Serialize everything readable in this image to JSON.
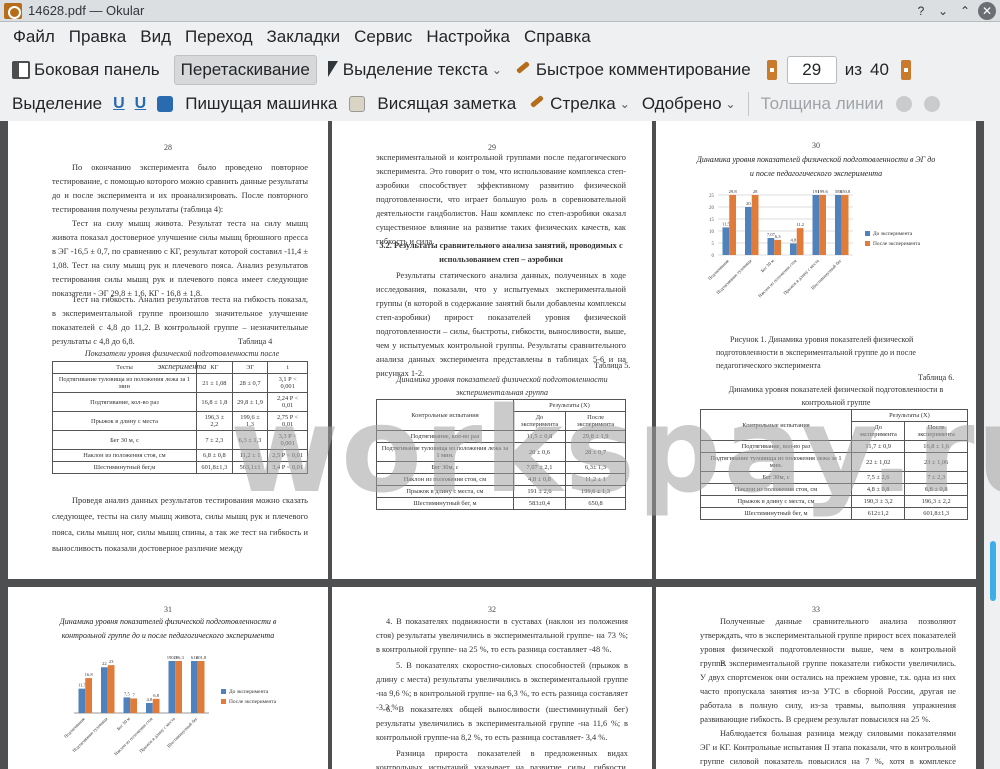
{
  "window": {
    "title": "14628.pdf — Okular"
  },
  "menu": [
    "Файл",
    "Правка",
    "Вид",
    "Переход",
    "Закладки",
    "Сервис",
    "Настройка",
    "Справка"
  ],
  "toolbar1": {
    "sidebar": "Боковая панель",
    "drag": "Перетаскивание",
    "text_select": "Выделение текста",
    "quick_comment": "Быстрое комментирование",
    "current_page": "29",
    "of_label": "из",
    "total_pages": "40"
  },
  "toolbar2": {
    "highlight": "Выделение",
    "typewriter": "Пишущая машинка",
    "sticky_note": "Висящая заметка",
    "arrow": "Стрелка",
    "approved": "Одобрено",
    "line_width": "Толщина линии"
  },
  "watermark": "workspay.ru",
  "pages": {
    "p28": {
      "num": "28",
      "paras": [
        "По окончанию эксперимента было проведено повторное тестирование, с помощью которого можно сравнить данные результаты до и после эксперимента и их проанализировать. После повторного тестирования получены результаты (таблица 4):",
        "Тест на силу мышц живота. Результат теста на силу мышц живота показал достоверное улучшение силы мышц брюшного пресса в ЭГ -16,5 ± 0,7, по сравнению с КГ, результат которой составил -11,4 ± 1,08.",
        "Тест на силу мышц рук и плечевого пояса. Анализ результатов тестирования силы мышц рук и плечевого пояса имеет следующие показатели - ЭГ 29,8 ± 1,6, КГ - 16,8 ± 1,8.",
        "Тест на гибкость. Анализ результатов теста на гибкость показал, в экспериментальной группе произошло значительное улучшение показателей с 4,8 до 11,2. В контрольной группе – незначительные результаты с 4,8 до 6,8."
      ],
      "table_label": "Таблица 4",
      "table_title": "Показатели уровня физической подготовленности после эксперимента",
      "table_head": [
        "Тесты",
        "КГ",
        "ЭГ",
        "t"
      ],
      "table_rows": [
        [
          "Подтягивание туловища из положения лежа за 1 мин",
          "21 ± 1,08",
          "28 ± 0,7",
          "3,1 P < 0,001"
        ],
        [
          "Подтягивание, кол-во раз",
          "16,8 ± 1,8",
          "29,8 ± 1,9",
          "2,24 P < 0,01"
        ],
        [
          "Прыжок в длину с места",
          "196,3 ± 2,2",
          "199,6 ± 1,3",
          "2,75 P < 0,01"
        ],
        [
          "Бег 30 м, с",
          "7 ± 2,3",
          "6,3 ± 1,3",
          "3,3 P < 0,001"
        ],
        [
          "Наклон из положения стоя, см",
          "6,8 ± 0,8",
          "11,2 ± 1",
          "2,5 P < 0,01"
        ],
        [
          "Шестиминутный бег,м",
          "601,8±1,3",
          "563,1±1",
          "3,4 P < 0,01"
        ]
      ],
      "after": "Проведя анализ данных результатов тестирования можно сказать следующее, тесты на силу мышц живота, силы мышц рук и плечевого пояса, силы мышц ног, силы мышц спины, а так же тест на гибкость и выносливость показали достоверное различие между"
    },
    "p29": {
      "num": "29",
      "para1": "экспериментальной и контрольной группами после педагогического эксперимента. Это говорит о том, что использование комплекса степ-аэробики способствует эффективному развитию физической подготовленности, что играет большую роль в соревновательной деятельности гандболистов. Наш комплекс по степ-аэробики оказал существенное влияние на развитие таких физических качеств, как гибкость и сила.",
      "heading": "3.2. Результаты сравнительного анализа занятий, проводимых с использованием степ – аэробики",
      "para2": "Результаты статического анализа данных, полученных в ходе исследования, показали, что у испытуемых экспериментальной группы (в которой в содержание занятий были добавлены комплексы степ-аэробики) прирост показателей уровня физической подготовленности – силы, быстроты, гибкости, выносливости, выше, чем у испытуемых контрольной группы. Результаты сравнительного анализа данных эксперимента представлены в таблицах 5-6 и на рисунках 1-2.",
      "table_label": "Таблица 5.",
      "table_title": "Динамика уровня показателей физической подготовленности экспериментальная группа",
      "head_test": "Контрольные испытания",
      "head_results": "Результаты (X)",
      "head_before": "До эксперимента",
      "head_after": "После эксперимента",
      "rows": [
        [
          "Подтягивание, кол-во раз",
          "11,5 ± 0,8",
          "29,8 ± 1,9"
        ],
        [
          "Подтягивание туловища из положения лежа за 1 мин.",
          "20 ± 0,6",
          "28 ± 0,7"
        ],
        [
          "Бег 30м, с",
          "7,07 ± 2,1",
          "6,3± 1,3"
        ],
        [
          "Наклон из положения стоя, см",
          "4,8 ± 0,8",
          "11,2 ± 1"
        ],
        [
          "Прыжок в длину с места, см",
          "191 ± 2,6",
          "199,6 ± 1,3"
        ],
        [
          "Шестиминутный бег, м",
          "583±0,4",
          "650,8"
        ]
      ]
    },
    "p30": {
      "num": "30",
      "chart_title": "Динамика уровня показателей физической подготовленности в ЭГ до и после педагогического эксперимента",
      "caption": "Рисунок 1. Динамика уровня показателей физической подготовленности в экспериментальной группе до и после педагогического эксперимента",
      "table_label": "Таблица 6.",
      "table_title": "Динамика уровня показателей физической подготовленности в контрольной группе",
      "head_test": "Контрольные испытания",
      "head_results": "Результаты (X)",
      "head_before": "До эксперимента",
      "head_after": "После эксперимента",
      "rows": [
        [
          "Подтягивание, кол-во раз",
          "11,7 ± 0,9",
          "16,8 ± 1,6"
        ],
        [
          "Подтягивание туловища из положения лежа за 1 мин.",
          "22 ± 1,02",
          "23 ± 1,06"
        ],
        [
          "Бег 30м, с",
          "7,5 ± 2,6",
          "7 ± 2,3"
        ],
        [
          "Наклон из положения стоя, см",
          "4,8 ± 0,8",
          "6,8 ± 0,8"
        ],
        [
          "Прыжок в длину с места, см",
          "190,3 ± 3,2",
          "196,3 ± 2,2"
        ],
        [
          "Шестиминутный бег, м",
          "612±1,2",
          "601,8±1,3"
        ]
      ]
    },
    "p31": {
      "num": "31",
      "chart_title": "Динамика уровня показателей физической подготовленности в контрольной группе до и после педагогического эксперимента"
    },
    "p32": {
      "num": "32",
      "items": [
        "4. В показателях подвижности в суставах (наклон из положения стоя) результаты увеличились в экспериментальной группе- на 73 %; в контрольной группе- на 25 %, то есть разница составляет -48 %.",
        "5. В показателях скоростно-силовых способностей (прыжок в длину с места) результаты увеличились в экспериментальной группе -на 9,6 %; в контрольной группе- на 6,3 %, то есть разница составляет -3,3 %",
        "6. В показателях общей выносливости (шестиминутный бег) результаты увеличились в экспериментальной группе -на 11,6 %; в контрольной группе-на 8,2 %, то есть разница составляет- 3,4 %.",
        "Разница прироста показателей в предложенных видах контрольных испытаний указывает на развитие силы, гибкости, быстроты и выносливости"
      ]
    },
    "p33": {
      "num": "33",
      "paras": [
        "Полученные данные сравнительного анализа позволяют утверждать, что в экспериментальной группе прирост всех показателей уровня физической подготовленности выше, чем в контрольной группе.",
        "В экспериментальной группе показатели гибкости увеличились. У двух спортсменок они остались на прежнем уровне, т.к. одна из них часто пропускала занятия из-за УТС в сборной России, другая не работала в полную силу, из-за травмы, выполняя упражнения развивающие гибкость. В среднем результат повысился на 25 %.",
        "Наблюдается большая разница между силовыми показателями ЭГ и КГ. Контрольные испытания II этапа показали, что в контрольной группе силовой показатель повысился на 7 %, хотя в комплексе присутствовали"
      ]
    }
  },
  "chart_data": [
    {
      "type": "bar",
      "title": "Динамика уровня показателей физической подготовленности в ЭГ до и после педагогического эксперимента",
      "categories": [
        "Подтягивание",
        "Подтягивание туловища",
        "Бег 30 м",
        "Наклон из положения стоя",
        "Прыжок в длину с места",
        "Шестиминутный бег"
      ],
      "series": [
        {
          "name": "До эксперимента",
          "values": [
            11.5,
            20,
            7.07,
            4.8,
            191,
            583
          ],
          "color": "#4f81bd"
        },
        {
          "name": "После эксперимента",
          "values": [
            29.8,
            28,
            6.3,
            11.2,
            199.6,
            650.8
          ],
          "color": "#e07b39"
        }
      ],
      "data_labels": [
        "11,5",
        "20",
        "7,07",
        "4,8",
        "191",
        "583",
        "29,8",
        "28",
        "6,3",
        "11,2",
        "199,6",
        "650,8"
      ],
      "ylim": [
        0,
        25
      ],
      "yticks": [
        "0",
        "5",
        "10",
        "15",
        "20",
        "25"
      ],
      "legend": "right"
    },
    {
      "type": "bar",
      "title": "Динамика уровня показателей физической подготовленности в контрольной группе до и после педагогического эксперимента",
      "categories": [
        "Подтягивание",
        "Подтягивание туловища",
        "Бег 30 м",
        "Наклон из положения стоя",
        "Прыжок в длину с места",
        "Шестиминутный бег"
      ],
      "series": [
        {
          "name": "До эксперимента",
          "values": [
            11.7,
            22,
            7.5,
            4.8,
            190.3,
            612
          ],
          "color": "#4f81bd"
        },
        {
          "name": "После эксперимента",
          "values": [
            16.8,
            23,
            7,
            6.8,
            196.3,
            601.8
          ],
          "color": "#e07b39"
        }
      ],
      "data_labels": [
        "11,7",
        "22",
        "7,5",
        "4,8",
        "190,3",
        "612",
        "16,8",
        "23",
        "7",
        "6,8",
        "196,3",
        "601,8"
      ],
      "legend": "right"
    }
  ]
}
